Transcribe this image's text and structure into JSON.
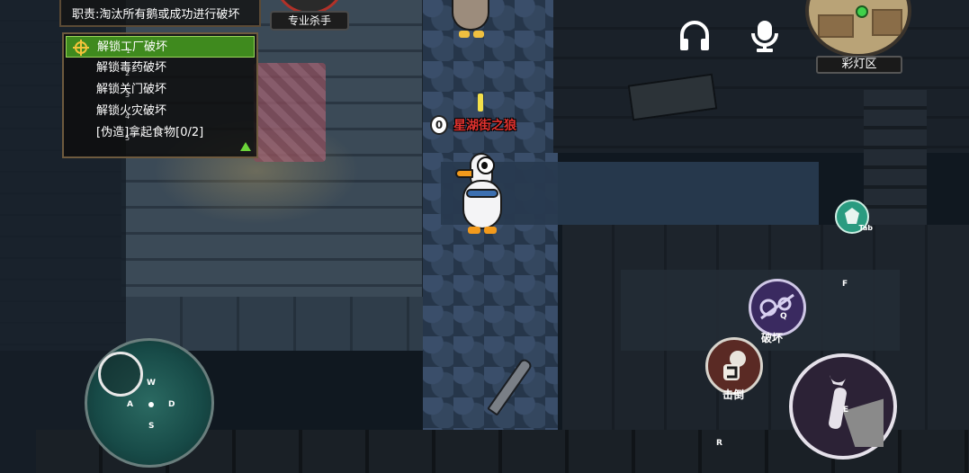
{
  "role": {
    "duty": "职责:淘汰所有鹅或成功进行破坏",
    "badge": "专业杀手"
  },
  "tasks": [
    {
      "label": "解锁工厂破坏",
      "num": "1",
      "active": true
    },
    {
      "label": "解锁毒药破坏",
      "num": "2",
      "active": false
    },
    {
      "label": "解锁关门破坏",
      "num": "3",
      "active": false
    },
    {
      "label": "解锁火灾破坏",
      "num": "4",
      "active": false
    },
    {
      "label": "[伪造]拿起食物[0/2]",
      "num": "5",
      "active": false
    }
  ],
  "player": {
    "vote_count": "0",
    "name": "星湖街之狼"
  },
  "map": {
    "location": "彩灯区"
  },
  "controls": {
    "joystick_keys": {
      "up": "W",
      "left": "A",
      "right": "D",
      "down": "S"
    },
    "sabotage_label": "破坏",
    "sabotage_key": "Q",
    "kill_label": "击倒",
    "use_key": "E",
    "tab_key": "Tab",
    "interact_key": "F",
    "report_key": "R"
  },
  "icons": {
    "headphones": "headphones-icon",
    "microphone": "microphone-icon",
    "target": "target-icon",
    "collapse": "triangle-up-icon"
  },
  "colors": {
    "active_task": "#3f8a1e",
    "player_name": "#e0322f",
    "panel_border": "#6e5a3e"
  }
}
